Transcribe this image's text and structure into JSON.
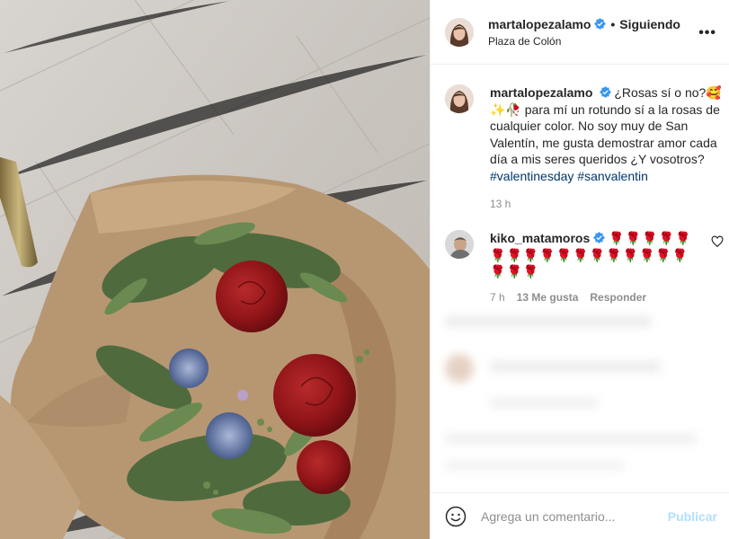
{
  "post": {
    "author": "martalopezalamo",
    "follow_state": "Siguiendo",
    "separator": "•",
    "location": "Plaza de Colón",
    "more_icon": "more-options-icon"
  },
  "caption": {
    "author": "martalopezalamo",
    "text_lead": "¿Rosas sí o no?🥰✨🥀 para mí un rotundo sí a la rosas de cualquier color. No soy muy de San Valentín, me gusta demostrar amor cada día a mis seres queridos ¿Y vosotros? ",
    "hashtags": [
      "#valentinesday",
      "#sanvalentin"
    ],
    "time": "13 h"
  },
  "comment": {
    "author": "kiko_matamoros",
    "roses_count": 20,
    "rose_icon": "rose-emoji",
    "time": "7 h",
    "likes": "13 Me gusta",
    "reply_label": "Responder"
  },
  "composer": {
    "placeholder": "Agrega un comentario...",
    "publish_label": "Publicar"
  },
  "colors": {
    "verified": "#3897f0",
    "hashtag": "#00376b",
    "publish_disabled": "#b2dffc",
    "muted": "#8e8e8e"
  }
}
